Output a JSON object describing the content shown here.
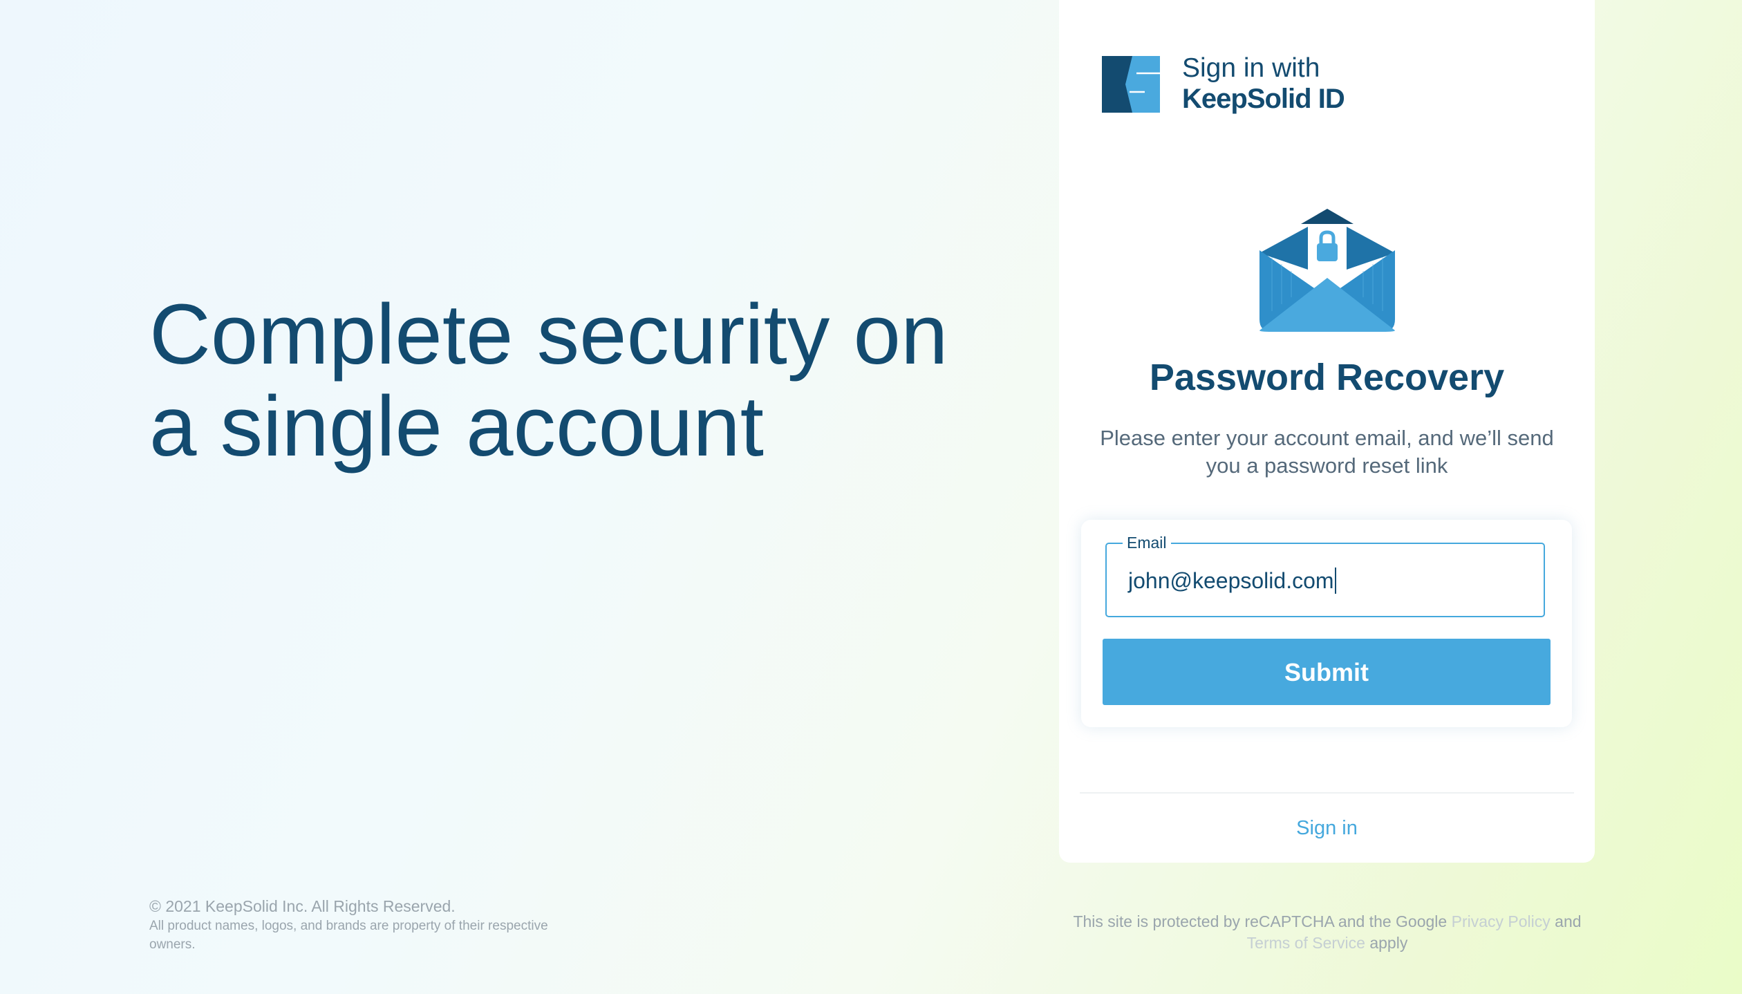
{
  "hero": {
    "line1": "Complete security on",
    "line2": "a single account"
  },
  "brand": {
    "line1": "Sign in with",
    "line2": "KeepSolid ID",
    "logo_icon": "keepsolid-logo"
  },
  "recovery": {
    "illustration": "envelope-lock-icon",
    "title": "Password Recovery",
    "description": "Please enter your account email, and we’ll send you a password reset link",
    "email_label": "Email",
    "email_value": "john@keepsolid.com",
    "submit_label": "Submit",
    "signin_link": "Sign in"
  },
  "footer": {
    "copyright": "© 2021 KeepSolid Inc. All Rights Reserved.",
    "owners": "All product names, logos, and brands are property of their respective owners.",
    "recaptcha_prefix": "This site is protected by reCAPTCHA and the Google",
    "privacy_link": "Privacy Policy",
    "and": "and",
    "terms_link": "Terms of Service",
    "suffix": "apply"
  },
  "colors": {
    "brand_dark": "#134b70",
    "accent": "#47a9de",
    "muted": "#9aa5ad"
  }
}
